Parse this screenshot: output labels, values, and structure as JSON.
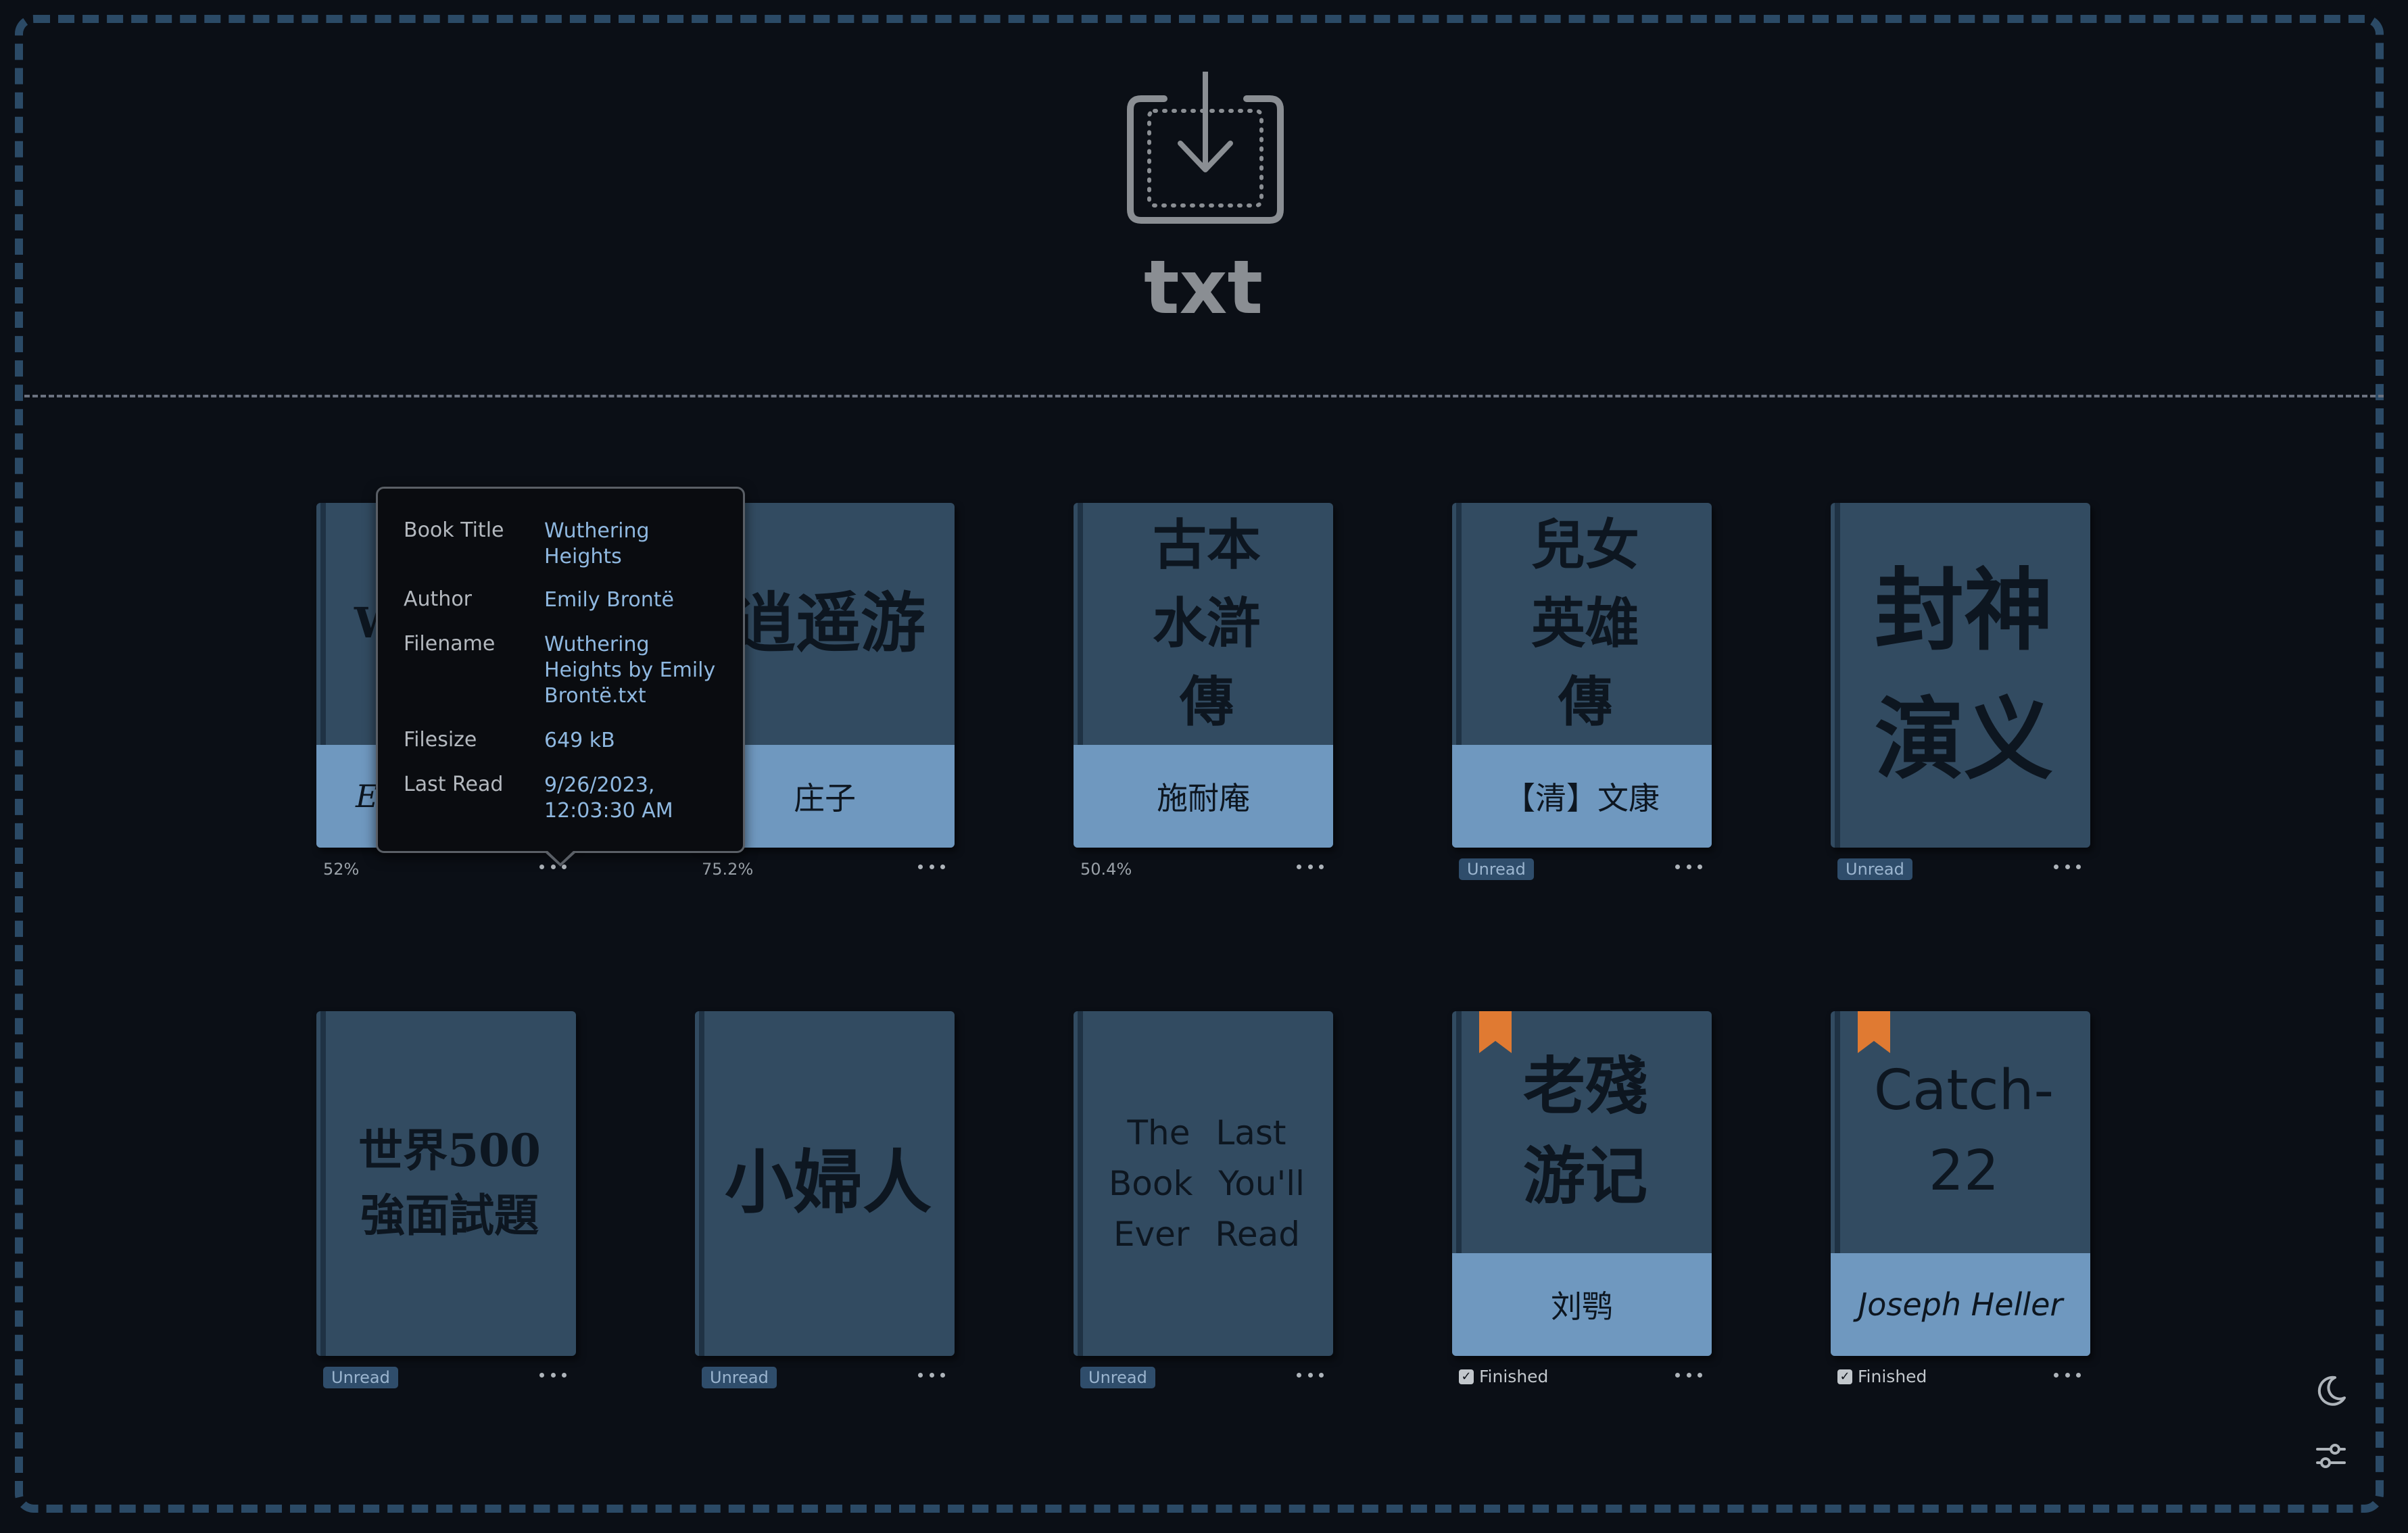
{
  "upload": {
    "label": "txt",
    "icon": "download-tray-icon"
  },
  "colors": {
    "background": "#0b0f16",
    "dashed_border": "#2b4a66",
    "cover": "#324b61",
    "author_band": "#6f98bf",
    "badge": "#2f4d6b",
    "bookmark": "#e07a32",
    "tooltip_value": "#8fb8e0"
  },
  "tooltip": {
    "rows": [
      {
        "label": "Book Title",
        "value": "Wuthering Heights"
      },
      {
        "label": "Author",
        "value": "Emily Brontë"
      },
      {
        "label": "Filename",
        "value": "Wuthering Heights by Emily Brontë.txt"
      },
      {
        "label": "Filesize",
        "value": "649 kB"
      },
      {
        "label": "Last Read",
        "value": "9/26/2023, 12:03:30 AM"
      }
    ]
  },
  "books": [
    {
      "title": "W",
      "author": "E",
      "status": "52%"
    },
    {
      "title": "逍遥游",
      "author": "庄子",
      "status": "75.2%"
    },
    {
      "title": "古本水滸傳",
      "author": "施耐庵",
      "status": "50.4%"
    },
    {
      "title": "兒女英雄傳",
      "author": "【清】文康",
      "status": "Unread"
    },
    {
      "title": "封神演义",
      "author": "",
      "status": "Unread"
    },
    {
      "title": "世界500強面試題",
      "author": "",
      "status": "Unread"
    },
    {
      "title": "小婦人",
      "author": "",
      "status": "Unread"
    },
    {
      "title": "The Last Book You'll Ever Read",
      "author": "",
      "status": "Unread"
    },
    {
      "title": "老殘游记",
      "author": "刘鹗",
      "status": "Finished"
    },
    {
      "title": "Catch-22",
      "author": "Joseph Heller",
      "status": "Finished"
    }
  ],
  "corner": {
    "theme_icon": "moon-icon",
    "settings_icon": "sliders-icon"
  }
}
